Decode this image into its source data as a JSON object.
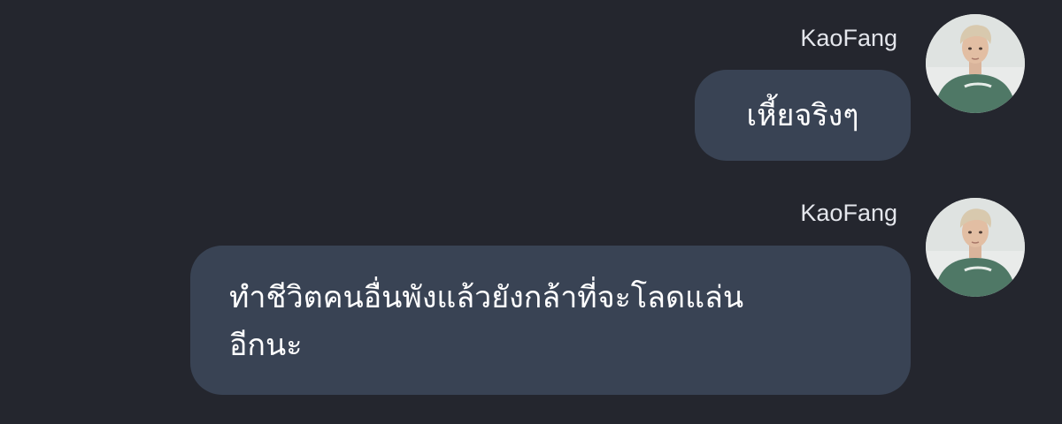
{
  "messages": [
    {
      "sender": "KaoFang",
      "text": "เหี้ยจริงๆ",
      "colors": {
        "bubble": "#394354",
        "text": "#ffffff"
      }
    },
    {
      "sender": "KaoFang",
      "text_lines": [
        "ทำชีวิตคนอื่นพังแล้วยังกล้าที่จะโลดแล่น",
        "อีกนะ"
      ],
      "colors": {
        "bubble": "#394354",
        "text": "#ffffff"
      }
    }
  ],
  "theme": {
    "background": "#24262e",
    "name_color": "#e4e6ec"
  },
  "icons": [
    "avatar-image"
  ]
}
